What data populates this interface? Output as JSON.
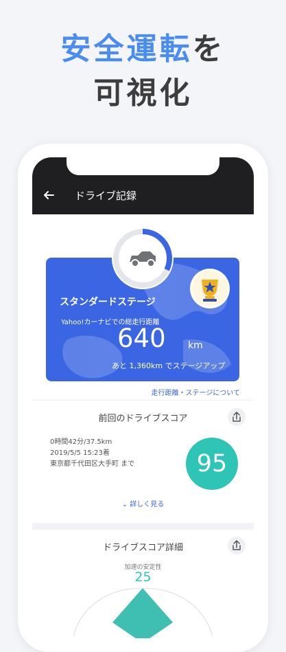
{
  "headline": {
    "line1_accent": "安全運転",
    "line1_rest": "を",
    "line2": "可視化"
  },
  "colors": {
    "accent": "#4a8cf0",
    "card_blue": "#3b66e3",
    "score_teal": "#2ec4b6",
    "appbar": "#1f1f21"
  },
  "appbar": {
    "title": "ドライブ記録",
    "back_icon": "back-arrow-icon"
  },
  "stage_card": {
    "stage_name": "スタンダードステージ",
    "distance_label": "Yahoo!カーナビでの総走行距離",
    "distance_value": "640",
    "distance_unit": "km",
    "next_stage_text": "あと 1,360km でステージアップ",
    "progress_fraction": 0.32,
    "icons": [
      "car-icon",
      "trophy-icon"
    ]
  },
  "stage_link": "走行距離・ステージについて",
  "last_score": {
    "title": "前回のドライブスコア",
    "duration": "0時間42分/37.5km",
    "datetime": "2019/5/5 15:23着",
    "destination": "東京都千代田区大手町 まで",
    "score": "95",
    "detail_link": "詳しく見る"
  },
  "score_detail": {
    "title": "ドライブスコア詳細",
    "metric_label": "加速の安定性",
    "metric_value": "25"
  }
}
